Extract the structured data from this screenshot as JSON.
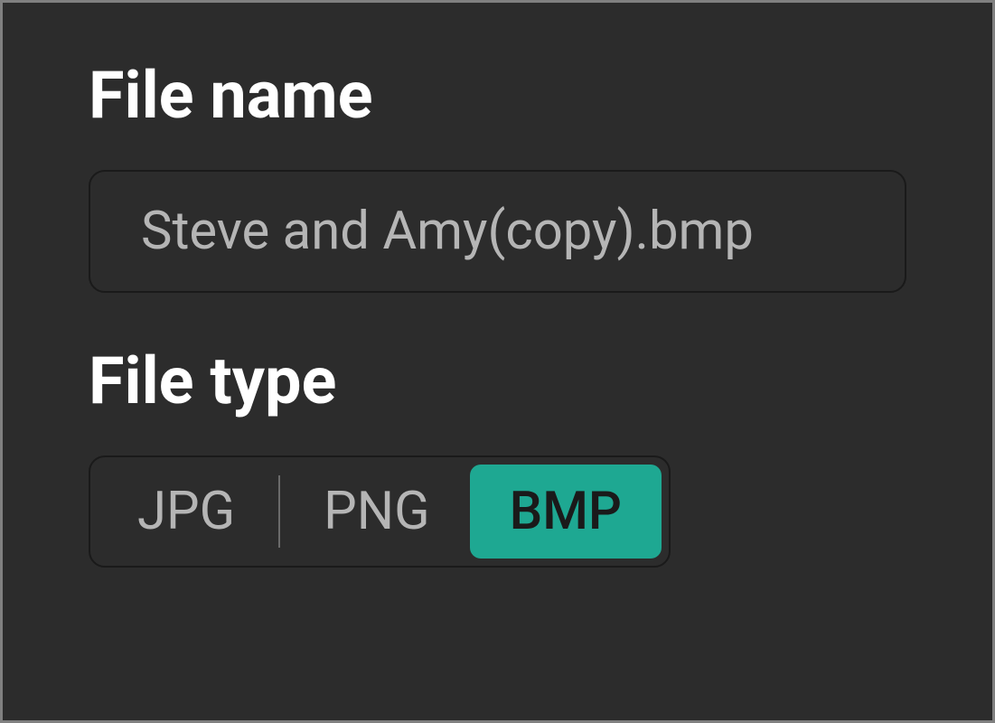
{
  "file_name": {
    "label": "File name",
    "value": "Steve and Amy(copy).bmp"
  },
  "file_type": {
    "label": "File type",
    "options": [
      "JPG",
      "PNG",
      "BMP"
    ],
    "selected": "BMP"
  }
}
